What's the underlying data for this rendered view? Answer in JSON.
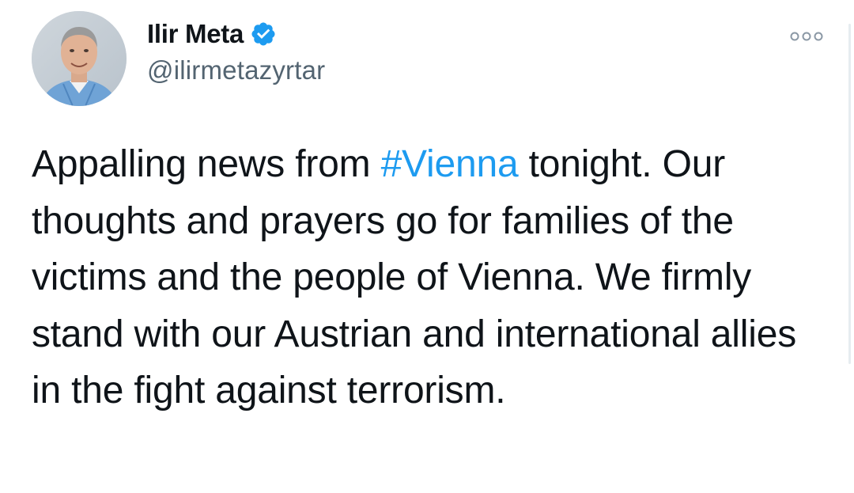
{
  "tweet": {
    "author": {
      "display_name": "Ilir Meta",
      "handle": "@ilirmetazyrtar",
      "verified": true,
      "avatar_icon": "profile-photo"
    },
    "more_icon": "more-options-icon",
    "text": {
      "part1": "Appalling news from ",
      "hashtag": "#Vienna",
      "part2": " tonight. Our thoughts and prayers go for families of the victims and the people of Vienna. We firmly stand with our Austrian and international allies in the fight against terrorism."
    },
    "colors": {
      "hashtag": "#1d9bf0",
      "verified_badge": "#1d9bf0",
      "handle": "#536471",
      "text": "#0f1419"
    }
  }
}
